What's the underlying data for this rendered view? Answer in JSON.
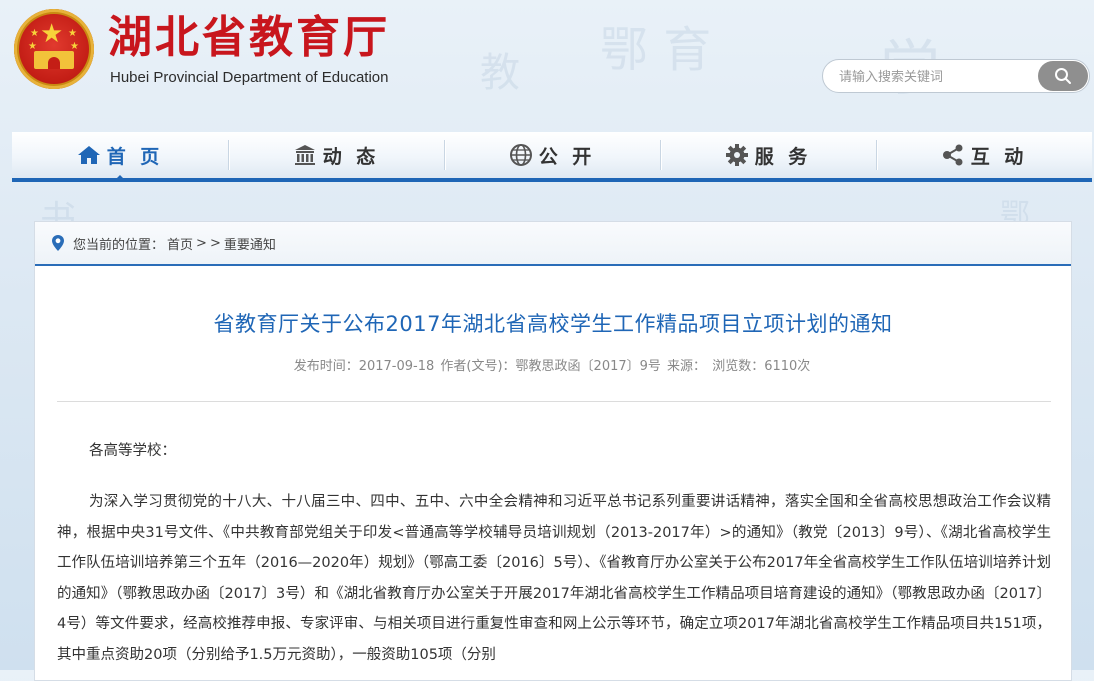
{
  "header": {
    "site_title": "湖北省教育厅",
    "site_subtitle": "Hubei Provincial Department of Education",
    "search_placeholder": "请输入搜索关键词"
  },
  "nav": {
    "items": [
      {
        "label": "首 页",
        "icon": "home-icon",
        "active": true
      },
      {
        "label": "动 态",
        "icon": "building-icon",
        "active": false
      },
      {
        "label": "公 开",
        "icon": "globe-icon",
        "active": false
      },
      {
        "label": "服 务",
        "icon": "gear-icon",
        "active": false
      },
      {
        "label": "互 动",
        "icon": "share-icon",
        "active": false
      }
    ]
  },
  "breadcrumb": {
    "prefix": "您当前的位置：",
    "home": "首页",
    "sep": ">",
    "sep2": ">",
    "current": "重要通知"
  },
  "article": {
    "title": "省教育厅关于公布2017年湖北省高校学生工作精品项目立项计划的通知",
    "meta_published": "发布时间：2017-09-18",
    "meta_doc": "作者(文号)：鄂教思政函〔2017〕9号",
    "meta_source": "来源：",
    "meta_views": "浏览数：6110次",
    "salutation": "各高等学校：",
    "paragraph": "为深入学习贯彻党的十八大、十八届三中、四中、五中、六中全会精神和习近平总书记系列重要讲话精神，落实全国和全省高校思想政治工作会议精神，根据中央31号文件、《中共教育部党组关于印发<普通高等学校辅导员培训规划（2013-2017年）>的通知》（教党〔2013〕9号）、《湖北省高校学生工作队伍培训培养第三个五年（2016—2020年）规划》（鄂高工委〔2016〕5号）、《省教育厅办公室关于公布2017年全省高校学生工作队伍培训培养计划的通知》（鄂教思政办函〔2017〕3号）和《湖北省教育厅办公室关于开展2017年湖北省高校学生工作精品项目培育建设的通知》（鄂教思政办函〔2017〕4号）等文件要求，经高校推荐申报、专家评审、与相关项目进行重复性审查和网上公示等环节，确定立项2017年湖北省高校学生工作精品项目共151项，其中重点资助20项（分别给予1.5万元资助），一般资助105项（分别"
  },
  "colors": {
    "brand_red": "#c8161d",
    "nav_blue": "#1f66b6",
    "title_blue": "#1f66b6"
  }
}
